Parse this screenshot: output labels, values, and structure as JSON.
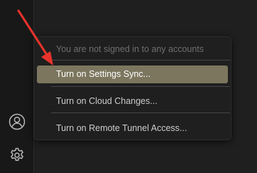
{
  "activity_bar": {
    "accounts_icon": "account-circle-icon",
    "manage_icon": "gear-icon"
  },
  "accounts_menu": {
    "status_text": "You are not signed in to any accounts",
    "items": [
      {
        "label": "Turn on Settings Sync...",
        "selected": true
      },
      {
        "label": "Turn on Cloud Changes...",
        "selected": false
      },
      {
        "label": "Turn on Remote Tunnel Access...",
        "selected": false
      }
    ]
  },
  "annotation": {
    "type": "red-arrow",
    "color": "#e8332b"
  },
  "colors": {
    "background": "#1f1f1f",
    "activity_bar": "#181818",
    "selected_item": "#7c765e",
    "menu_text": "#cccccc",
    "disabled_text": "#6e6e6e",
    "icon": "#b8b8b8"
  }
}
